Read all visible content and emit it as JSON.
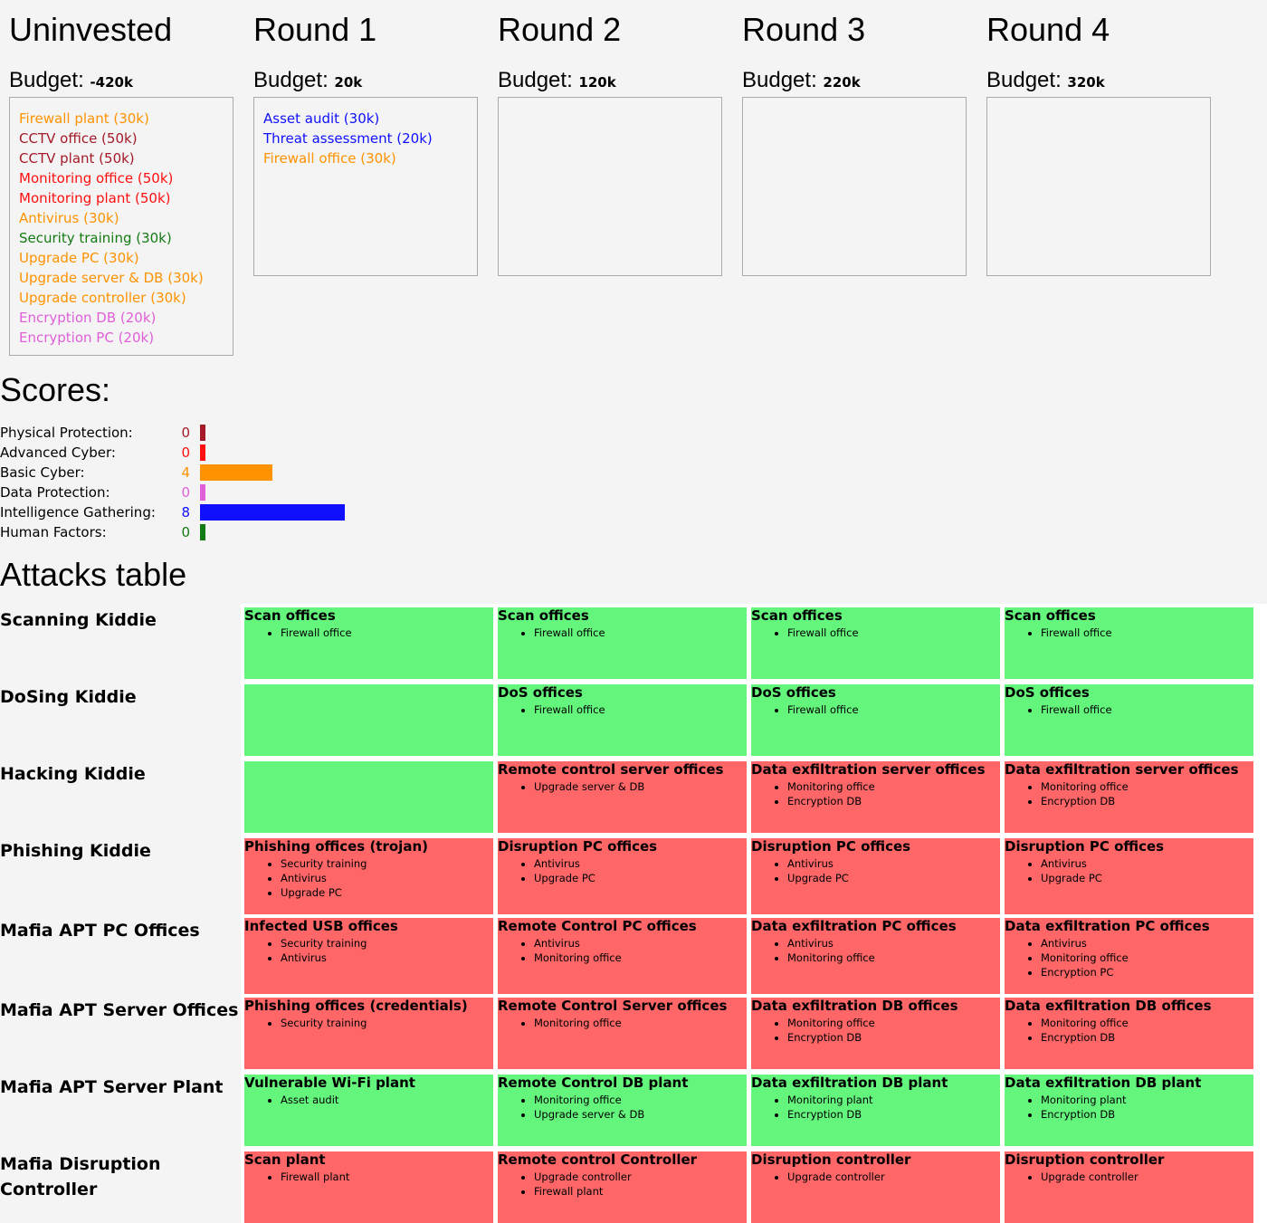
{
  "colors": {
    "orange": "#ff9200",
    "darkred": "#a41a28",
    "red": "#ff1010",
    "green": "#147a14",
    "pink": "#e05fd8",
    "blue": "#1010ff",
    "cell_green": "#64f57c",
    "cell_red": "#fe6668"
  },
  "rounds": [
    {
      "title": "Uninvested",
      "budget_label": "Budget:",
      "budget": "-420k",
      "items": [
        {
          "label": "Firewall plant (30k)",
          "color": "#ff9200"
        },
        {
          "label": "CCTV office (50k)",
          "color": "#a41a28"
        },
        {
          "label": "CCTV plant (50k)",
          "color": "#a41a28"
        },
        {
          "label": "Monitoring office (50k)",
          "color": "#ff1010"
        },
        {
          "label": "Monitoring plant (50k)",
          "color": "#ff1010"
        },
        {
          "label": "Antivirus (30k)",
          "color": "#ff9200"
        },
        {
          "label": "Security training (30k)",
          "color": "#147a14"
        },
        {
          "label": "Upgrade PC (30k)",
          "color": "#ff9200"
        },
        {
          "label": "Upgrade server & DB (30k)",
          "color": "#ff9200"
        },
        {
          "label": "Upgrade controller (30k)",
          "color": "#ff9200"
        },
        {
          "label": "Encryption DB (20k)",
          "color": "#e05fd8"
        },
        {
          "label": "Encryption PC (20k)",
          "color": "#e05fd8"
        }
      ]
    },
    {
      "title": "Round 1",
      "budget_label": "Budget:",
      "budget": "20k",
      "items": [
        {
          "label": "Asset audit (30k)",
          "color": "#1010ff"
        },
        {
          "label": "Threat assessment (20k)",
          "color": "#1010ff"
        },
        {
          "label": "Firewall office (30k)",
          "color": "#ff9200"
        }
      ]
    },
    {
      "title": "Round 2",
      "budget_label": "Budget:",
      "budget": "120k",
      "items": []
    },
    {
      "title": "Round 3",
      "budget_label": "Budget:",
      "budget": "220k",
      "items": []
    },
    {
      "title": "Round 4",
      "budget_label": "Budget:",
      "budget": "320k",
      "items": []
    }
  ],
  "scores": {
    "title": "Scores:",
    "max_score": 8,
    "items": [
      {
        "label": "Physical Protection:",
        "value": "0",
        "score": 0,
        "color": "#a41a28"
      },
      {
        "label": "Advanced Cyber:",
        "value": "0",
        "score": 0,
        "color": "#ff1010"
      },
      {
        "label": "Basic Cyber:",
        "value": "4",
        "score": 4,
        "color": "#ff9200"
      },
      {
        "label": "Data Protection:",
        "value": "0",
        "score": 0,
        "color": "#e05fd8"
      },
      {
        "label": "Intelligence Gathering:",
        "value": "8",
        "score": 8,
        "color": "#1010ff"
      },
      {
        "label": "Human Factors:",
        "value": "0",
        "score": 0,
        "color": "#147a14"
      }
    ]
  },
  "attacks": {
    "title": "Attacks table",
    "rows": [
      {
        "label": "Scanning Kiddie",
        "cells": [
          {
            "status": "green",
            "title": "Scan offices",
            "items": [
              "Firewall office"
            ]
          },
          {
            "status": "green",
            "title": "Scan offices",
            "items": [
              "Firewall office"
            ]
          },
          {
            "status": "green",
            "title": "Scan offices",
            "items": [
              "Firewall office"
            ]
          },
          {
            "status": "green",
            "title": "Scan offices",
            "items": [
              "Firewall office"
            ]
          }
        ]
      },
      {
        "label": "DoSing Kiddie",
        "cells": [
          {
            "status": "green",
            "title": "",
            "items": []
          },
          {
            "status": "green",
            "title": "DoS offices",
            "items": [
              "Firewall office"
            ]
          },
          {
            "status": "green",
            "title": "DoS offices",
            "items": [
              "Firewall office"
            ]
          },
          {
            "status": "green",
            "title": "DoS offices",
            "items": [
              "Firewall office"
            ]
          }
        ]
      },
      {
        "label": "Hacking Kiddie",
        "cells": [
          {
            "status": "green",
            "title": "",
            "items": []
          },
          {
            "status": "red",
            "title": "Remote control server offices",
            "items": [
              "Upgrade server & DB"
            ]
          },
          {
            "status": "red",
            "title": "Data exfiltration server offices",
            "items": [
              "Monitoring office",
              "Encryption DB"
            ]
          },
          {
            "status": "red",
            "title": "Data exfiltration server offices",
            "items": [
              "Monitoring office",
              "Encryption DB"
            ]
          }
        ]
      },
      {
        "label": "Phishing Kiddie",
        "cells": [
          {
            "status": "red",
            "title": "Phishing offices (trojan)",
            "items": [
              "Security training",
              "Antivirus",
              "Upgrade PC"
            ]
          },
          {
            "status": "red",
            "title": "Disruption PC offices",
            "items": [
              "Antivirus",
              "Upgrade PC"
            ]
          },
          {
            "status": "red",
            "title": "Disruption PC offices",
            "items": [
              "Antivirus",
              "Upgrade PC"
            ]
          },
          {
            "status": "red",
            "title": "Disruption PC offices",
            "items": [
              "Antivirus",
              "Upgrade PC"
            ]
          }
        ]
      },
      {
        "label": "Mafia APT PC Offices",
        "cells": [
          {
            "status": "red",
            "title": "Infected USB offices",
            "items": [
              "Security training",
              "Antivirus"
            ]
          },
          {
            "status": "red",
            "title": "Remote Control PC offices",
            "items": [
              "Antivirus",
              "Monitoring office"
            ]
          },
          {
            "status": "red",
            "title": "Data exfiltration PC offices",
            "items": [
              "Antivirus",
              "Monitoring office"
            ]
          },
          {
            "status": "red",
            "title": "Data exfiltration PC offices",
            "items": [
              "Antivirus",
              "Monitoring office",
              "Encryption PC"
            ]
          }
        ]
      },
      {
        "label": "Mafia APT Server Offices",
        "cells": [
          {
            "status": "red",
            "title": "Phishing offices (credentials)",
            "items": [
              "Security training"
            ]
          },
          {
            "status": "red",
            "title": "Remote Control Server offices",
            "items": [
              "Monitoring office"
            ]
          },
          {
            "status": "red",
            "title": "Data exfiltration DB offices",
            "items": [
              "Monitoring office",
              "Encryption DB"
            ]
          },
          {
            "status": "red",
            "title": "Data exfiltration DB offices",
            "items": [
              "Monitoring office",
              "Encryption DB"
            ]
          }
        ]
      },
      {
        "label": "Mafia APT Server Plant",
        "cells": [
          {
            "status": "green",
            "title": "Vulnerable Wi-Fi plant",
            "items": [
              "Asset audit"
            ]
          },
          {
            "status": "green",
            "title": "Remote Control DB plant",
            "items": [
              "Monitoring office",
              "Upgrade server & DB"
            ]
          },
          {
            "status": "green",
            "title": "Data exfiltration DB plant",
            "items": [
              "Monitoring plant",
              "Encryption DB"
            ]
          },
          {
            "status": "green",
            "title": "Data exfiltration DB plant",
            "items": [
              "Monitoring plant",
              "Encryption DB"
            ]
          }
        ]
      },
      {
        "label": "Mafia Disruption Controller",
        "cells": [
          {
            "status": "red",
            "title": "Scan plant",
            "items": [
              "Firewall plant"
            ]
          },
          {
            "status": "red",
            "title": "Remote control Controller",
            "items": [
              "Upgrade controller",
              "Firewall plant"
            ]
          },
          {
            "status": "red",
            "title": "Disruption controller",
            "items": [
              "Upgrade controller"
            ]
          },
          {
            "status": "red",
            "title": "Disruption controller",
            "items": [
              "Upgrade controller"
            ]
          }
        ]
      }
    ]
  }
}
